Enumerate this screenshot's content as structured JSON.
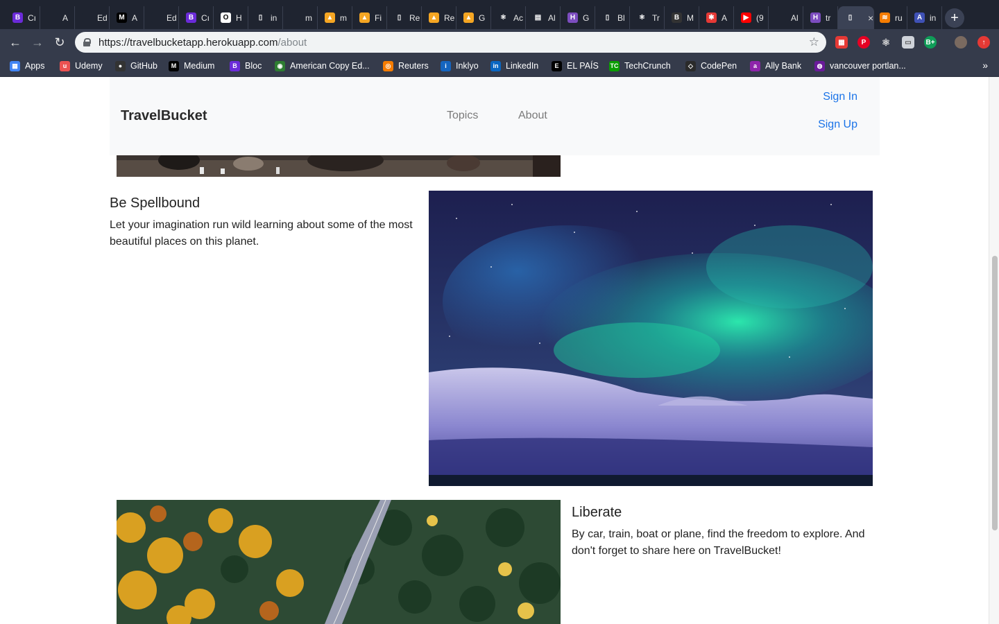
{
  "browser": {
    "tabs": [
      {
        "fav": "B",
        "title": "Cı",
        "color": "#6b2bd9"
      },
      {
        "fav": "",
        "title": "A",
        "color": "#1f2430"
      },
      {
        "fav": "",
        "title": "Ed",
        "color": "#1f2430"
      },
      {
        "fav": "M",
        "title": "A",
        "color": "#000000"
      },
      {
        "fav": "",
        "title": "Ed",
        "color": "#1f2430"
      },
      {
        "fav": "B",
        "title": "Cı",
        "color": "#6b2bd9"
      },
      {
        "fav": "O",
        "title": "H",
        "color": "#ffffff"
      },
      {
        "fav": "▯",
        "title": "in",
        "color": "#1f2430"
      },
      {
        "fav": "",
        "title": "m",
        "color": "#1f2430"
      },
      {
        "fav": "▲",
        "title": "m",
        "color": "#f5a623"
      },
      {
        "fav": "▲",
        "title": "Fi",
        "color": "#f5a623"
      },
      {
        "fav": "▯",
        "title": "Re",
        "color": "#1f2430"
      },
      {
        "fav": "▲",
        "title": "Re",
        "color": "#f5a623"
      },
      {
        "fav": "▲",
        "title": "G",
        "color": "#f5a623"
      },
      {
        "fav": "⚛",
        "title": "Ac",
        "color": "#1f2430"
      },
      {
        "fav": "▤",
        "title": "Al",
        "color": "#1f2430"
      },
      {
        "fav": "H",
        "title": "G",
        "color": "#7c4dbf"
      },
      {
        "fav": "▯",
        "title": "Bl",
        "color": "#1f2430"
      },
      {
        "fav": "⚛",
        "title": "Tr",
        "color": "#1f2430"
      },
      {
        "fav": "B",
        "title": "M",
        "color": "#333333"
      },
      {
        "fav": "✱",
        "title": "A",
        "color": "#e53935"
      },
      {
        "fav": "▶",
        "title": "(9",
        "color": "#ff0000"
      },
      {
        "fav": "",
        "title": "Al",
        "color": "#1f2430"
      },
      {
        "fav": "H",
        "title": "tr",
        "color": "#7c4dbf"
      },
      {
        "fav": "▯",
        "title": "",
        "color": "#3b4255",
        "active": true
      },
      {
        "fav": "≋",
        "title": "ru",
        "color": "#f57c00"
      },
      {
        "fav": "A",
        "title": "in",
        "color": "#3f51b5"
      }
    ],
    "new_tab": "+",
    "url_host": "https://travelbucketapp.herokuapp.com",
    "url_path": "/about",
    "star_icon": "☆",
    "bookmarks": [
      {
        "label": "Apps",
        "icon": "▦",
        "color": "#4285f4"
      },
      {
        "label": "Udemy",
        "icon": "u",
        "color": "#ec5252"
      },
      {
        "label": "GitHub",
        "icon": "●",
        "color": "#333333"
      },
      {
        "label": "Medium",
        "icon": "M",
        "color": "#000000"
      },
      {
        "label": "Bloc",
        "icon": "B",
        "color": "#6b2bd9"
      },
      {
        "label": "American Copy Ed...",
        "icon": "◉",
        "color": "#2e7d32"
      },
      {
        "label": "Reuters",
        "icon": "◎",
        "color": "#f57c00"
      },
      {
        "label": "Inklyo",
        "icon": "i",
        "color": "#1565c0"
      },
      {
        "label": "LinkedIn",
        "icon": "in",
        "color": "#0a66c2"
      },
      {
        "label": "EL PAÍS",
        "icon": "E",
        "color": "#000000"
      },
      {
        "label": "TechCrunch",
        "icon": "TC",
        "color": "#0a9e01"
      },
      {
        "label": "CodePen",
        "icon": "◇",
        "color": "#2a2a2a"
      },
      {
        "label": "Ally Bank",
        "icon": "a",
        "color": "#8e24aa"
      },
      {
        "label": "vancouver portlan...",
        "icon": "◍",
        "color": "#6a1b9a"
      }
    ],
    "bookmarks_more": "»"
  },
  "site": {
    "brand": "TravelBucket",
    "nav": {
      "topics": "Topics",
      "about": "About"
    },
    "auth": {
      "sign_in": "Sign In",
      "sign_up": "Sign Up"
    }
  },
  "content": {
    "section1": {
      "heading": "Be Spellbound",
      "text": "Let your imagination run wild learning about some of the most beautiful places on this planet."
    },
    "section2": {
      "heading": "Liberate",
      "text": "By car, train, boat or plane, find the freedom to explore. And don't forget to share here on TravelBucket!"
    }
  }
}
